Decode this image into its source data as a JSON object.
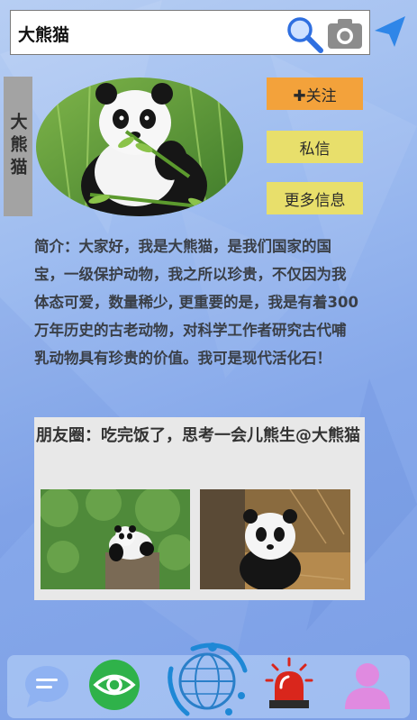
{
  "search": {
    "query": "大熊猫"
  },
  "profile": {
    "name": "大熊猫",
    "buttons": {
      "follow": "✚关注",
      "message": "私信",
      "more": "更多信息"
    },
    "intro": "简介：大家好，我是大熊猫，是我们国家的国宝，一级保护动物，我之所以珍贵，不仅因为我体态可爱，数量稀少, 更重要的是，我是有着300万年历史的古老动物，对科学工作者研究古代哺乳动物具有珍贵的价值。我可是现代活化石！"
  },
  "moments": {
    "text": "朋友圈：吃完饭了，思考一会儿熊生@大熊猫"
  },
  "nav": {
    "items": [
      {
        "icon": "chat-bubble-icon"
      },
      {
        "icon": "eye-icon"
      },
      {
        "icon": "globe-icon"
      },
      {
        "icon": "alarm-light-icon"
      },
      {
        "icon": "user-icon"
      }
    ]
  },
  "colors": {
    "follow": "#f3a23b",
    "secondary_button": "#e8df6b",
    "name_tab": "#a3a3a3",
    "nav_chat": "#8fb2f2",
    "nav_eye": "#2fb24a",
    "nav_alarm": "#d9261c",
    "nav_user": "#e08ae0",
    "send": "#2f86e8"
  }
}
